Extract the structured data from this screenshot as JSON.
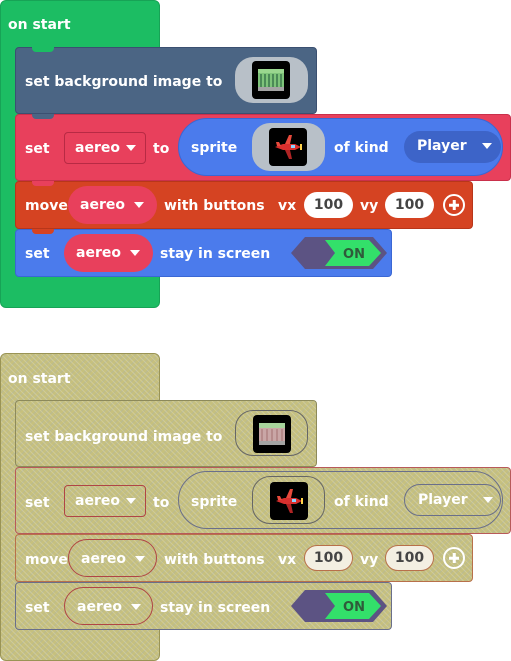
{
  "groups": [
    {
      "state": "enabled",
      "hat_label": "on start",
      "bg_block": {
        "label": "set background image to",
        "image_icon": "background-image-thumbnail"
      },
      "set_sprite_block": {
        "set_label": "set",
        "variable": "aereo",
        "to_label": "to",
        "sprite_label": "sprite",
        "sprite_icon": "red-airplane-sprite",
        "kind_label": "of kind",
        "kind_value": "Player"
      },
      "move_block": {
        "label": "move",
        "variable": "aereo",
        "with_label": "with buttons",
        "vx_label": "vx",
        "vx": "100",
        "vy_label": "vy",
        "vy": "100"
      },
      "stay_block": {
        "set_label": "set",
        "variable": "aereo",
        "label": "stay in screen",
        "toggle": "ON"
      }
    },
    {
      "state": "disabled",
      "hat_label": "on start",
      "bg_block": {
        "label": "set background image to",
        "image_icon": "background-image-thumbnail"
      },
      "set_sprite_block": {
        "set_label": "set",
        "variable": "aereo",
        "to_label": "to",
        "sprite_label": "sprite",
        "sprite_icon": "red-airplane-sprite",
        "kind_label": "of kind",
        "kind_value": "Player"
      },
      "move_block": {
        "label": "move",
        "variable": "aereo",
        "with_label": "with buttons",
        "vx_label": "vx",
        "vx": "100",
        "vy_label": "vy",
        "vy": "100"
      },
      "stay_block": {
        "set_label": "set",
        "variable": "aereo",
        "label": "stay in screen",
        "toggle": "ON"
      }
    }
  ],
  "colors": {
    "events_green": "#1cbd63",
    "scene_slate": "#4b6584",
    "sprites_pink": "#e8405c",
    "controller_orange": "#d54322",
    "sprites_blue": "#4b7bec",
    "disabled_khaki": "#c6c07e",
    "toggle_green": "#33e06a",
    "toggle_purple": "#5c5383"
  }
}
